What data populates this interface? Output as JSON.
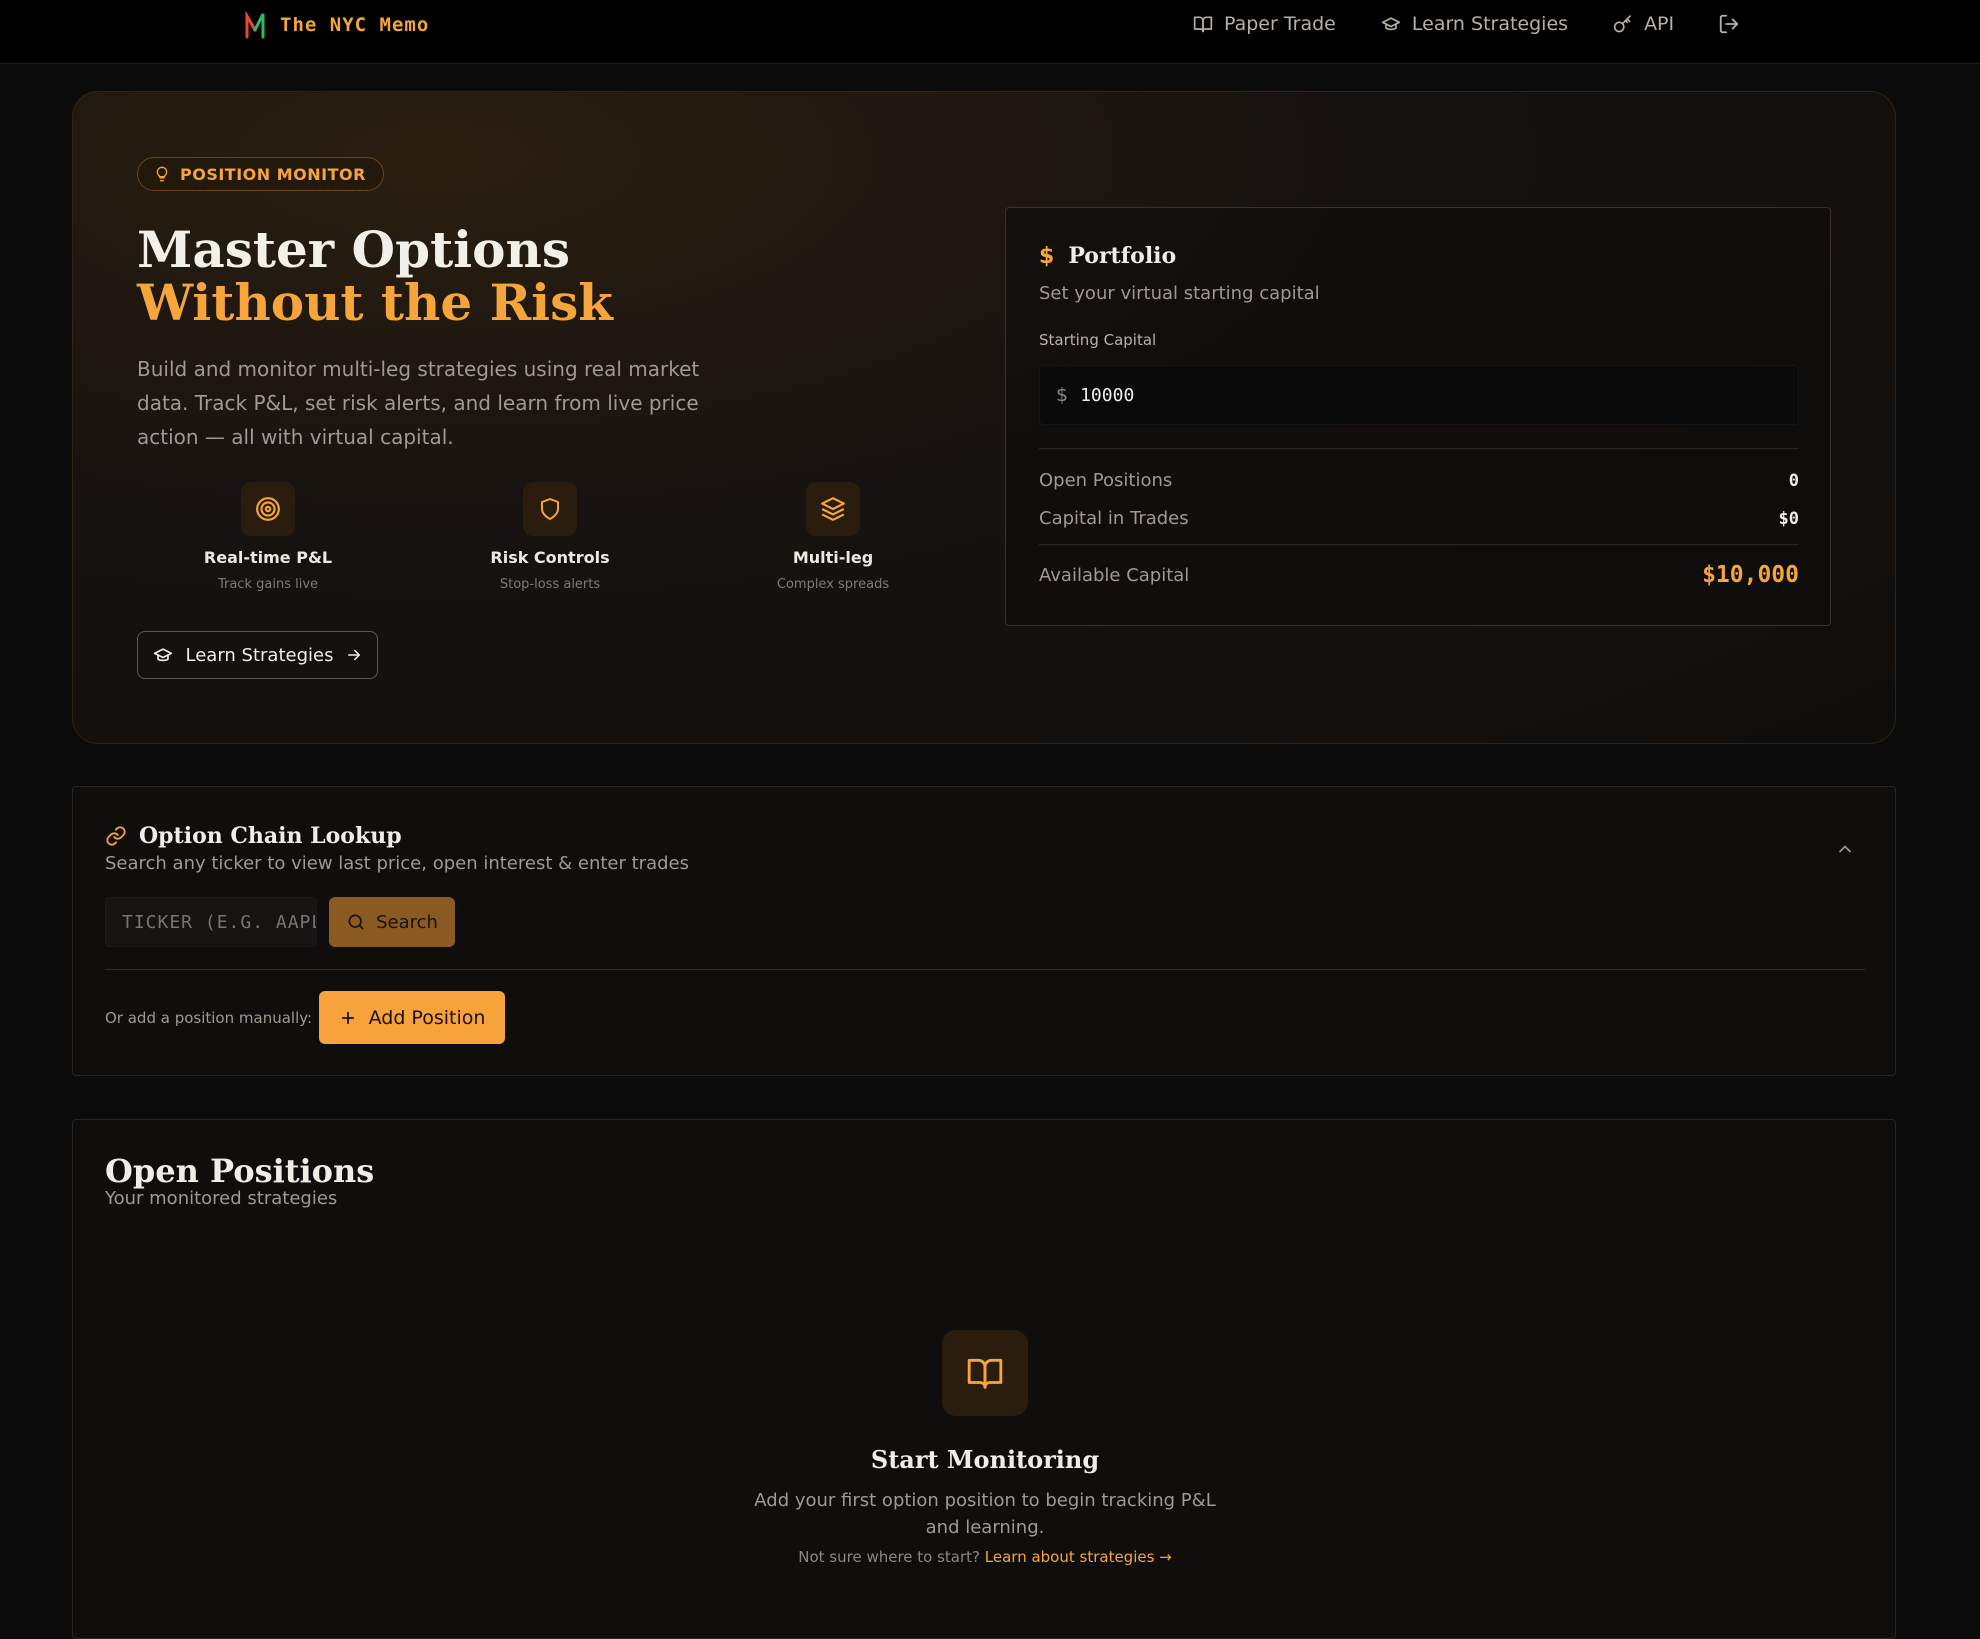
{
  "nav": {
    "brand": "The NYC Memo",
    "links": [
      {
        "label": "Paper Trade",
        "icon": "book-icon"
      },
      {
        "label": "Learn Strategies",
        "icon": "graduation-cap-icon"
      },
      {
        "label": "API",
        "icon": "key-icon"
      }
    ],
    "logout_icon": "logout-icon"
  },
  "hero": {
    "badge": "POSITION MONITOR",
    "title_line1": "Master Options",
    "title_line2": "Without the Risk",
    "description": "Build and monitor multi-leg strategies using real market data. Track P&L, set risk alerts, and learn from live price action — all with virtual capital.",
    "features": [
      {
        "title": "Real-time P&L",
        "subtitle": "Track gains live",
        "icon": "target-icon"
      },
      {
        "title": "Risk Controls",
        "subtitle": "Stop-loss alerts",
        "icon": "shield-icon"
      },
      {
        "title": "Multi-leg",
        "subtitle": "Complex spreads",
        "icon": "layers-icon"
      }
    ],
    "cta_label": "Learn Strategies"
  },
  "portfolio": {
    "title": "Portfolio",
    "subtitle": "Set your virtual starting capital",
    "capital_label": "Starting Capital",
    "currency_symbol": "$",
    "capital_value": "10000",
    "open_positions_label": "Open Positions",
    "open_positions_value": "0",
    "capital_in_trades_label": "Capital in Trades",
    "capital_in_trades_value": "$0",
    "available_label": "Available Capital",
    "available_value": "$10,000"
  },
  "chain": {
    "title": "Option Chain Lookup",
    "subtitle": "Search any ticker to view last price, open interest & enter trades",
    "ticker_placeholder": "TICKER (E.G. AAPL)",
    "search_label": "Search",
    "manual_label": "Or add a position manually:",
    "add_label": "Add Position"
  },
  "positions": {
    "title": "Open Positions",
    "subtitle": "Your monitored strategies",
    "empty_title": "Start Monitoring",
    "empty_desc": "Add your first option position to begin tracking P&L and learning.",
    "hint_text": "Not sure where to start?",
    "hint_link": "Learn about strategies →"
  },
  "colors": {
    "accent": "#f5a53a",
    "background": "#0b0b0b",
    "panel": "#0f0e0d"
  }
}
